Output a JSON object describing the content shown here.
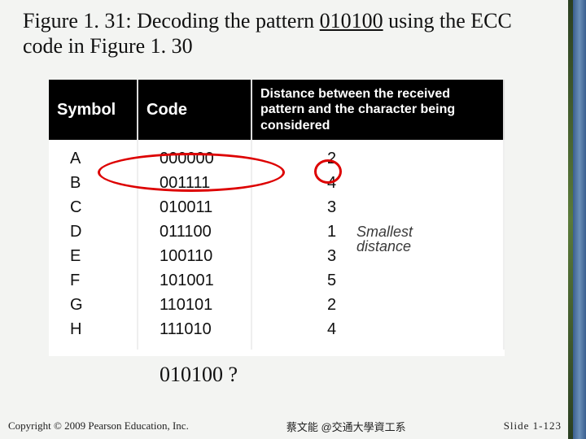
{
  "title": {
    "prefix": "Figure 1. 31:  Decoding the pattern ",
    "underlined": "010100",
    "suffix": " using the ECC code in Figure 1. 30"
  },
  "headers": {
    "symbol": "Symbol",
    "code": "Code",
    "distance": "Distance between the received pattern and the character being considered"
  },
  "rows": [
    {
      "symbol": "A",
      "code": "000000",
      "dist": "2"
    },
    {
      "symbol": "B",
      "code": "001111",
      "dist": "4"
    },
    {
      "symbol": "C",
      "code": "010011",
      "dist": "3"
    },
    {
      "symbol": "D",
      "code": "011100",
      "dist": "1"
    },
    {
      "symbol": "E",
      "code": "100110",
      "dist": "3"
    },
    {
      "symbol": "F",
      "code": "101001",
      "dist": "5"
    },
    {
      "symbol": "G",
      "code": "110101",
      "dist": "2"
    },
    {
      "symbol": "H",
      "code": "111010",
      "dist": "4"
    }
  ],
  "annotation": {
    "line1": "Smallest",
    "line2": "distance"
  },
  "question": "010100 ?",
  "footer": {
    "copyright": "Copyright © 2009 Pearson Education, Inc.",
    "center": "蔡文能 @交通大學資工系",
    "slide": "Slide 1-123"
  },
  "chart_data": {
    "type": "table",
    "title": "Figure 1.31: Decoding the pattern 010100 using the ECC code in Figure 1.30",
    "columns": [
      "Symbol",
      "Code",
      "Distance between the received pattern and the character being considered"
    ],
    "rows": [
      [
        "A",
        "000000",
        2
      ],
      [
        "B",
        "001111",
        4
      ],
      [
        "C",
        "010011",
        3
      ],
      [
        "D",
        "011100",
        1
      ],
      [
        "E",
        "100110",
        3
      ],
      [
        "F",
        "101001",
        5
      ],
      [
        "G",
        "110101",
        2
      ],
      [
        "H",
        "111010",
        4
      ]
    ],
    "received_pattern": "010100",
    "highlighted_row_index": 3,
    "annotation": "Smallest distance"
  }
}
